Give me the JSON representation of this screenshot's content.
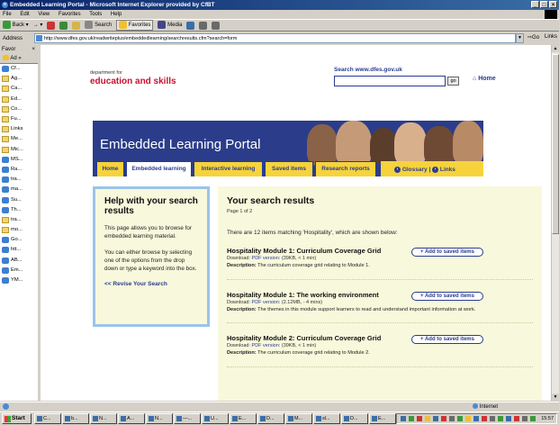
{
  "window": {
    "title": "Embedded Learning Portal - Microsoft Internet Explorer provided by CfBT"
  },
  "menu": [
    "File",
    "Edit",
    "View",
    "Favorites",
    "Tools",
    "Help"
  ],
  "toolbar": {
    "back": "Back",
    "search": "Search",
    "favorites": "Favorites",
    "media": "Media"
  },
  "address": {
    "label": "Address",
    "url": "http://www.dfes.gov.uk/readwriteplus/embeddedlearning/searchresults.cfm?search=form",
    "go": "Go",
    "links": "Links"
  },
  "favorites": {
    "header": "Favor",
    "add": "Ad",
    "items": [
      {
        "label": "Cf...",
        "type": "page"
      },
      {
        "label": "Ag...",
        "type": "folder"
      },
      {
        "label": "Ca...",
        "type": "folder"
      },
      {
        "label": "Ed...",
        "type": "folder"
      },
      {
        "label": "Co...",
        "type": "folder"
      },
      {
        "label": "Fu...",
        "type": "folder"
      },
      {
        "label": "Links",
        "type": "folder"
      },
      {
        "label": "Me...",
        "type": "folder"
      },
      {
        "label": "Mic...",
        "type": "folder"
      },
      {
        "label": "MS...",
        "type": "page"
      },
      {
        "label": "Ra...",
        "type": "page"
      },
      {
        "label": "tra...",
        "type": "page"
      },
      {
        "label": "ma...",
        "type": "page"
      },
      {
        "label": "Su...",
        "type": "page"
      },
      {
        "label": "Th...",
        "type": "page"
      },
      {
        "label": "tra...",
        "type": "folder"
      },
      {
        "label": "mo...",
        "type": "folder"
      },
      {
        "label": "Go...",
        "type": "page"
      },
      {
        "label": "htt...",
        "type": "page"
      },
      {
        "label": "AB...",
        "type": "page"
      },
      {
        "label": "Em...",
        "type": "page"
      },
      {
        "label": "YM...",
        "type": "page"
      }
    ]
  },
  "header": {
    "dept_for": "department for",
    "dept_name": "education and skills",
    "search_label": "Search www.dfes.gov.uk",
    "go": "go",
    "home": "Home"
  },
  "banner": {
    "title": "Embedded Learning Portal"
  },
  "nav": {
    "tabs": [
      "Home",
      "Embedded learning",
      "Interactive learning",
      "Saved items",
      "Research reports"
    ],
    "glossary": "Glossary",
    "links": "Links"
  },
  "help": {
    "title": "Help with your search results",
    "p1": "This page allows you to browse for embedded learning material.",
    "p2": "You can either browse by selecting one of the options from the drop down or type a keyword into the box.",
    "revise": "<< Revise Your Search"
  },
  "results": {
    "title": "Your search results",
    "page": "Page 1 of 2",
    "summary": "There are 12 items matching 'Hospitality', which are shown below:",
    "add_label": "+ Add to saved items",
    "items": [
      {
        "title": "Hospitality Module 1: Curriculum Coverage Grid",
        "dl_prefix": "Download:",
        "dl_link": "PDF version:",
        "dl_info": "(39KB, < 1 min)",
        "desc_label": "Description:",
        "desc": "The curriculum coverage grid relating to Module 1."
      },
      {
        "title": "Hospitality Module 1: The working environment",
        "dl_prefix": "Download:",
        "dl_link": "PDF version:",
        "dl_info": "(2.12MB, - 4 mins)",
        "desc_label": "Description:",
        "desc": "The themes in this module support learners to read and understand important information at work."
      },
      {
        "title": "Hospitality Module 2: Curriculum Coverage Grid",
        "dl_prefix": "Download:",
        "dl_link": "PDF version:",
        "dl_info": "(39KB, < 1 min)",
        "desc_label": "Description:",
        "desc": "The curriculum coverage grid relating to Module 2."
      }
    ]
  },
  "statusbar": {
    "zone": "Internet"
  },
  "taskbar": {
    "start": "Start",
    "tasks": [
      "C...",
      "b...",
      "N...",
      "A...",
      "N...",
      "—...",
      "U...",
      "E...",
      "D...",
      "M...",
      "sl...",
      "D...",
      "E..."
    ],
    "clock": "15:57"
  }
}
